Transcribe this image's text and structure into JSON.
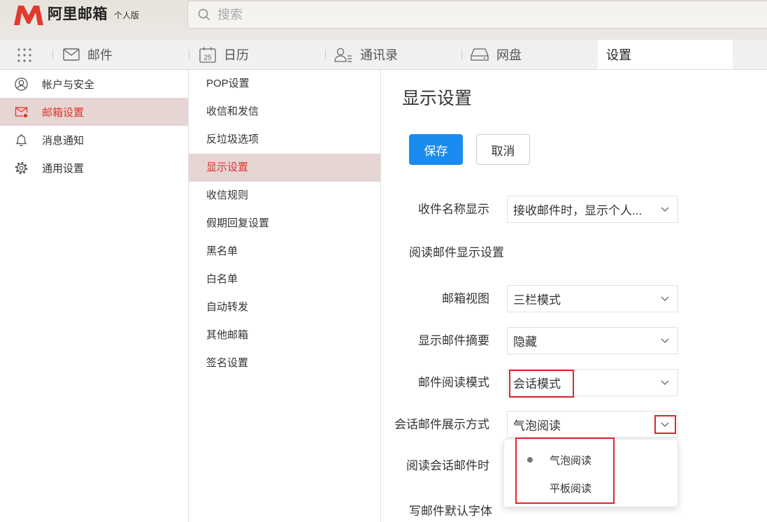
{
  "app": {
    "name": "阿里邮箱",
    "edition": "个人版"
  },
  "search": {
    "placeholder": "搜索",
    "icon": "search-icon"
  },
  "nav": {
    "apps_icon": "apps-grid-icon",
    "tabs": [
      {
        "label": "邮件",
        "icon": "mail-icon",
        "active": false
      },
      {
        "label": "日历",
        "icon": "calendar-icon",
        "icon_text": "25",
        "active": false
      },
      {
        "label": "通讯录",
        "icon": "contacts-icon",
        "active": false
      },
      {
        "label": "网盘",
        "icon": "drive-icon",
        "active": false
      },
      {
        "label": "设置",
        "active": true
      }
    ]
  },
  "sidebar": {
    "items": [
      {
        "label": "帐户与安全",
        "icon": "user-icon",
        "active": false
      },
      {
        "label": "邮箱设置",
        "icon": "mail-settings-icon",
        "active": true
      },
      {
        "label": "消息通知",
        "icon": "bell-icon",
        "active": false
      },
      {
        "label": "通用设置",
        "icon": "gear-icon",
        "active": false
      }
    ]
  },
  "submenu": {
    "items": [
      {
        "label": "POP设置",
        "active": false
      },
      {
        "label": "收信和发信",
        "active": false
      },
      {
        "label": "反垃圾选项",
        "active": false
      },
      {
        "label": "显示设置",
        "active": true
      },
      {
        "label": "收信规则",
        "active": false
      },
      {
        "label": "假期回复设置",
        "active": false
      },
      {
        "label": "黑名单",
        "active": false
      },
      {
        "label": "白名单",
        "active": false
      },
      {
        "label": "自动转发",
        "active": false
      },
      {
        "label": "其他邮箱",
        "active": false
      },
      {
        "label": "签名设置",
        "active": false
      }
    ]
  },
  "main": {
    "title": "显示设置",
    "save_label": "保存",
    "cancel_label": "取消",
    "recipient_name": {
      "label": "收件名称显示",
      "value": "接收邮件时，显示个人..."
    },
    "reading_section_title": "阅读邮件显示设置",
    "mailbox_view": {
      "label": "邮箱视图",
      "value": "三栏模式"
    },
    "show_summary": {
      "label": "显示邮件摘要",
      "value": "隐藏"
    },
    "reading_mode": {
      "label": "邮件阅读模式",
      "value": "会话模式"
    },
    "conversation_display": {
      "label": "会话邮件展示方式",
      "value": "气泡阅读",
      "dropdown_open": true,
      "options": [
        "气泡阅读",
        "平板阅读"
      ],
      "selected_index": 0
    },
    "conversation_reading": {
      "label": "阅读会话邮件时"
    },
    "default_font": {
      "label": "写邮件默认字体"
    }
  },
  "colors": {
    "accent": "#e0322d",
    "active_bg": "#e6d5d2",
    "primary": "#1a8cf0",
    "highlight": "#e5222b"
  }
}
